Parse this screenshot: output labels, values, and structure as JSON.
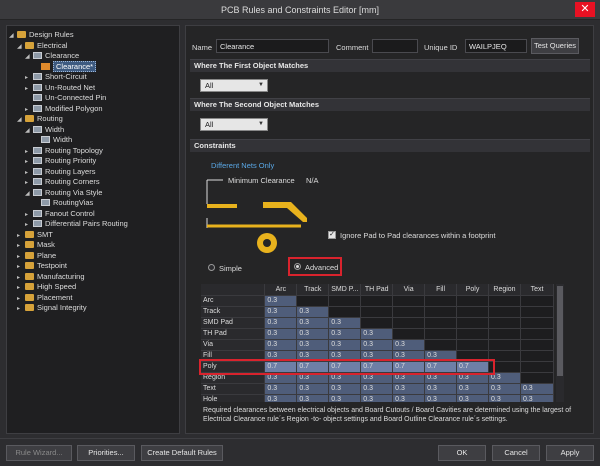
{
  "window": {
    "title": "PCB Rules and Constraints Editor [mm]",
    "close_glyph": "✕"
  },
  "tree": [
    {
      "label": "Design Rules",
      "icon": "folder",
      "arrow": "◢"
    },
    {
      "label": "Electrical",
      "icon": "folder",
      "arrow": "◢"
    },
    {
      "label": "Clearance",
      "icon": "rule",
      "arrow": "◢"
    },
    {
      "label": "Clearance*",
      "icon": "sel",
      "arrow": ""
    },
    {
      "label": "Short-Circuit",
      "icon": "rule",
      "arrow": "▸"
    },
    {
      "label": "Un-Routed Net",
      "icon": "rule",
      "arrow": "▸"
    },
    {
      "label": "Un-Connected Pin",
      "icon": "rule",
      "arrow": ""
    },
    {
      "label": "Modified Polygon",
      "icon": "rule",
      "arrow": "▸"
    },
    {
      "label": "Routing",
      "icon": "folder",
      "arrow": "◢"
    },
    {
      "label": "Width",
      "icon": "rule",
      "arrow": "◢"
    },
    {
      "label": "Width",
      "icon": "rule",
      "arrow": ""
    },
    {
      "label": "Routing Topology",
      "icon": "rule",
      "arrow": "▸"
    },
    {
      "label": "Routing Priority",
      "icon": "rule",
      "arrow": "▸"
    },
    {
      "label": "Routing Layers",
      "icon": "rule",
      "arrow": "▸"
    },
    {
      "label": "Routing Corners",
      "icon": "rule",
      "arrow": "▸"
    },
    {
      "label": "Routing Via Style",
      "icon": "rule",
      "arrow": "◢"
    },
    {
      "label": "RoutingVias",
      "icon": "rule",
      "arrow": ""
    },
    {
      "label": "Fanout Control",
      "icon": "rule",
      "arrow": "▸"
    },
    {
      "label": "Differential Pairs Routing",
      "icon": "rule",
      "arrow": "▸"
    },
    {
      "label": "SMT",
      "icon": "folder",
      "arrow": "▸"
    },
    {
      "label": "Mask",
      "icon": "folder",
      "arrow": "▸"
    },
    {
      "label": "Plane",
      "icon": "folder",
      "arrow": "▸"
    },
    {
      "label": "Testpoint",
      "icon": "folder",
      "arrow": "▸"
    },
    {
      "label": "Manufacturing",
      "icon": "folder",
      "arrow": "▸"
    },
    {
      "label": "High Speed",
      "icon": "folder",
      "arrow": "▸"
    },
    {
      "label": "Placement",
      "icon": "folder",
      "arrow": "▸"
    },
    {
      "label": "Signal Integrity",
      "icon": "folder",
      "arrow": "▸"
    }
  ],
  "rule": {
    "name_label": "Name",
    "name_value": "Clearance",
    "comment_label": "Comment",
    "comment_value": "",
    "uid_label": "Unique ID",
    "uid_value": "WAILPJEQ",
    "test_queries": "Test Queries"
  },
  "first_match": {
    "header": "Where The First Object Matches",
    "value": "All"
  },
  "second_match": {
    "header": "Where The Second Object Matches",
    "value": "All"
  },
  "constraints": {
    "header": "Constraints",
    "nets_link": "Different Nets Only",
    "min_clearance_label": "Minimum Clearance",
    "min_clearance_value": "N/A",
    "ignore_pad_label": "Ignore Pad to Pad clearances within a footprint",
    "ignore_pad_checked": "✓",
    "simple_label": "Simple",
    "advanced_label": "Advanced"
  },
  "grid": {
    "columns": [
      "Arc",
      "Track",
      "SMD P...",
      "TH Pad",
      "Via",
      "Fill",
      "Poly",
      "Region",
      "Text"
    ],
    "rows": [
      {
        "label": "Arc",
        "values": [
          "0.3"
        ]
      },
      {
        "label": "Track",
        "values": [
          "0.3",
          "0.3"
        ]
      },
      {
        "label": "SMD Pad",
        "values": [
          "0.3",
          "0.3",
          "0.3"
        ]
      },
      {
        "label": "TH Pad",
        "values": [
          "0.3",
          "0.3",
          "0.3",
          "0.3"
        ]
      },
      {
        "label": "Via",
        "values": [
          "0.3",
          "0.3",
          "0.3",
          "0.3",
          "0.3"
        ]
      },
      {
        "label": "Fill",
        "values": [
          "0.3",
          "0.3",
          "0.3",
          "0.3",
          "0.3",
          "0.3"
        ]
      },
      {
        "label": "Poly",
        "values": [
          "0.7",
          "0.7",
          "0.7",
          "0.7",
          "0.7",
          "0.7",
          "0.7"
        ],
        "highlight": true
      },
      {
        "label": "Region",
        "values": [
          "0.3",
          "0.3",
          "0.3",
          "0.3",
          "0.3",
          "0.3",
          "0.3",
          "0.3"
        ]
      },
      {
        "label": "Text",
        "values": [
          "0.3",
          "0.3",
          "0.3",
          "0.3",
          "0.3",
          "0.3",
          "0.3",
          "0.3",
          "0.3"
        ]
      },
      {
        "label": "Hole",
        "values": [
          "0.3",
          "0.3",
          "0.3",
          "0.3",
          "0.3",
          "0.3",
          "0.3",
          "0.3",
          "0.3"
        ]
      }
    ]
  },
  "note": "Required clearances between electrical objects and Board Cutouts / Board Cavities are determined using the largest of Electrical Clearance rule´s Region -to- object settings and Board Outline Clearance rule´s settings.",
  "footer": {
    "rule_wizard": "Rule Wizard...",
    "priorities": "Priorities...",
    "create_default": "Create Default Rules",
    "ok": "OK",
    "cancel": "Cancel",
    "apply": "Apply"
  },
  "colors": {
    "accent_red": "#d9232d",
    "highlight_row": "#6e7fa6",
    "cell": "#4f5d7a",
    "track_gold": "#e8b21d"
  }
}
